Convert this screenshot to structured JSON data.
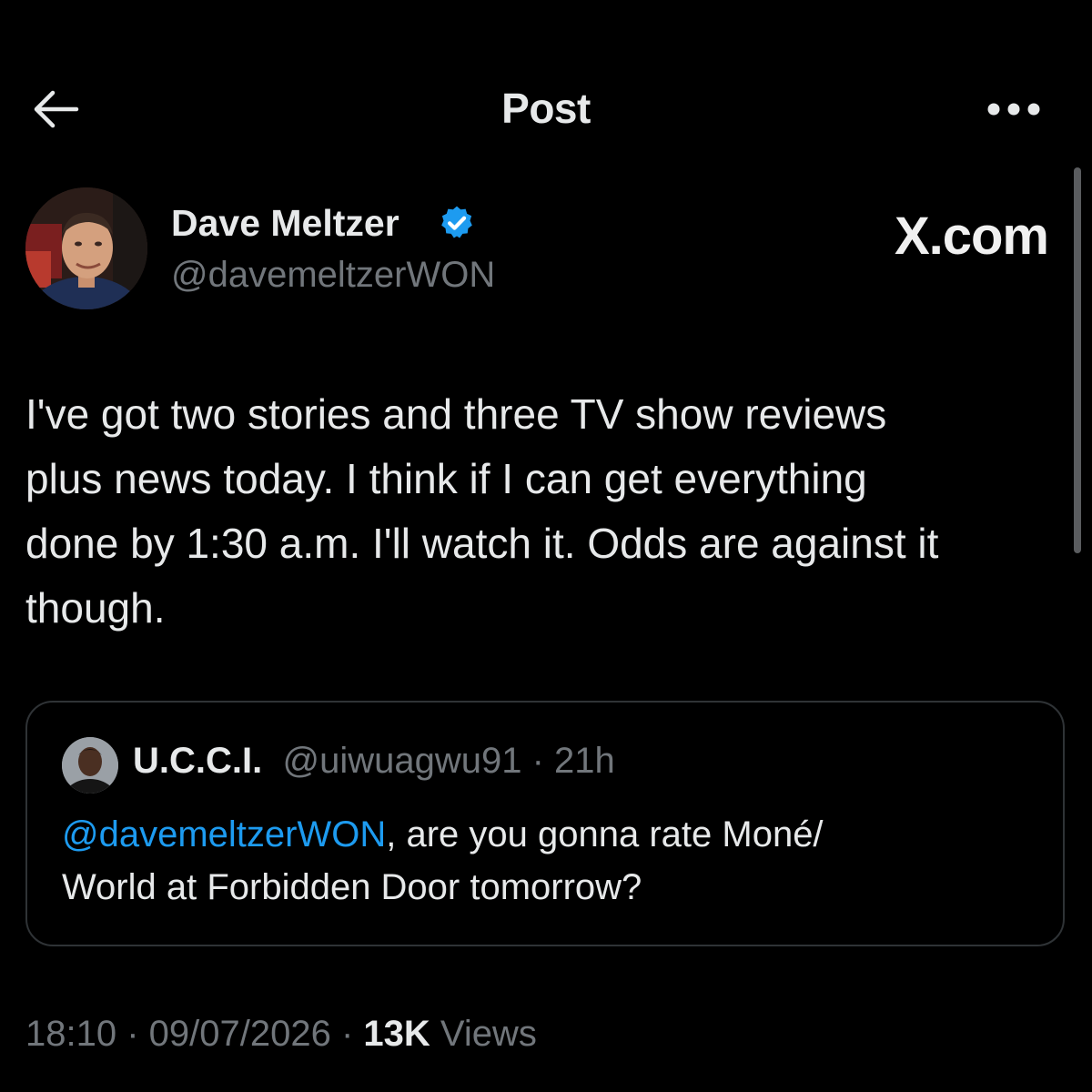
{
  "header": {
    "title": "Post",
    "back_icon": "arrow-left-icon",
    "more_icon": "ellipsis-icon"
  },
  "author": {
    "name": "Dave Meltzer",
    "handle": "@davemeltzerWON",
    "verified": true,
    "badge_color": "#1d9bf0"
  },
  "watermark": "X.com",
  "post": {
    "text": "I've got two stories and three TV show reviews\nplus news today.  I think if I can get everything\ndone by 1:30 a.m. I'll watch it.  Odds are against it\nthough."
  },
  "quote": {
    "name": "U.C.C.I.",
    "handle": "@uiwuagwu91",
    "separator": " · ",
    "time": "21h",
    "mention": "@davemeltzerWON",
    "text": ", are you gonna rate Moné/\nWorld at Forbidden Door tomorrow?"
  },
  "meta": {
    "time": "18:10",
    "separator": " · ",
    "date": "09/07/2026",
    "views_count": "13K",
    "views_label": "Views"
  },
  "colors": {
    "background": "#000000",
    "text_primary": "#e7e9ea",
    "text_secondary": "#71767b",
    "accent": "#1d9bf0",
    "border": "#2f3336"
  }
}
